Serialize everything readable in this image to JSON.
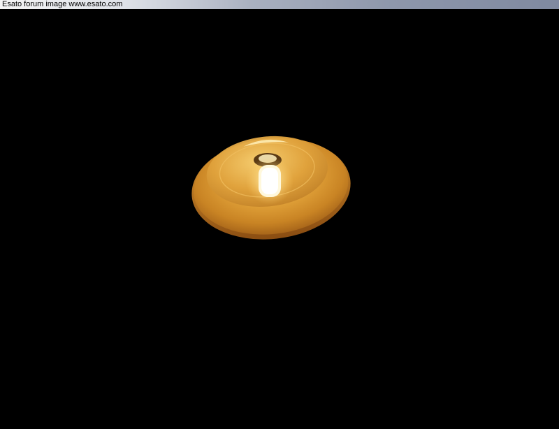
{
  "caption": {
    "text": "Esato forum image www.esato.com"
  },
  "photo": {
    "subject": "ceiling-lamp-with-glowing-bulb",
    "colors": {
      "background": "#000000",
      "shade_outer": "#b8731a",
      "shade_inner": "#e4a640",
      "bulb_glow": "#fff6c8"
    }
  }
}
